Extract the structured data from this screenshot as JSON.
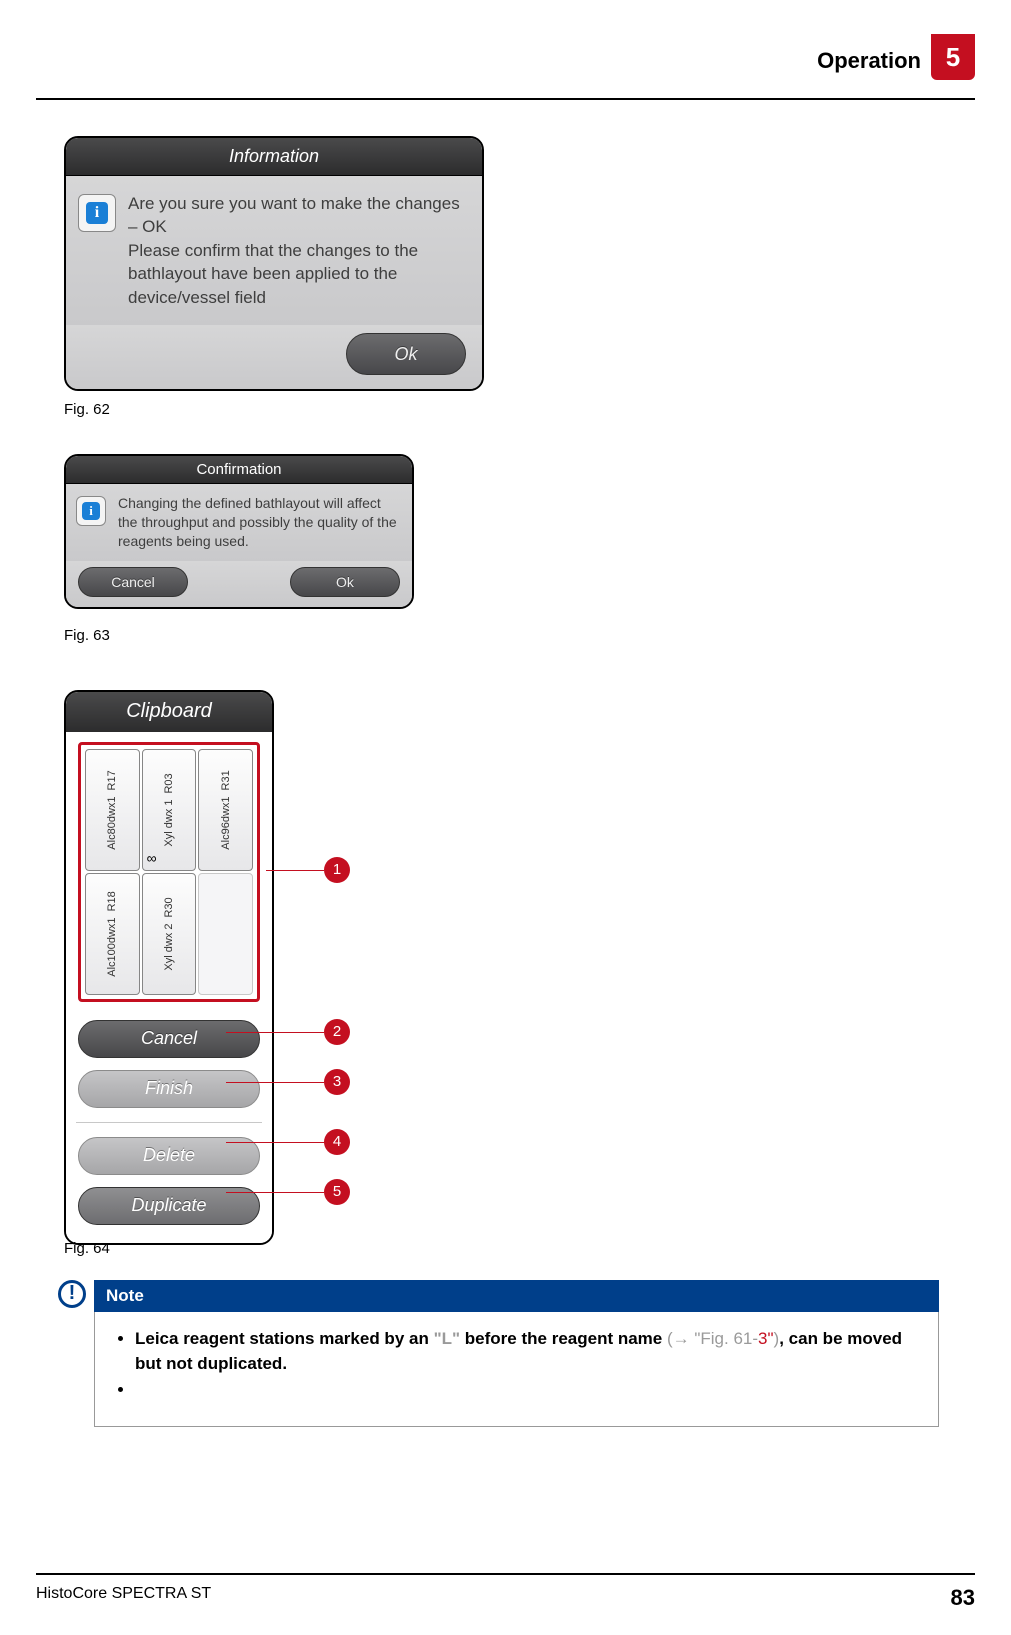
{
  "header": {
    "section": "Operation",
    "chapter": "5"
  },
  "dialog1": {
    "title": "Information",
    "text": "Are you sure you want to make the changes – OK\nPlease confirm that the changes to the bathlayout have been applied to the device/vessel field",
    "ok": "Ok",
    "caption": "Fig. 62"
  },
  "dialog2": {
    "title": "Confirmation",
    "text": "Changing the defined bathlayout will affect the throughput and possibly the quality of the reagents being used.",
    "cancel": "Cancel",
    "ok": "Ok",
    "caption": "Fig. 63"
  },
  "clipboard": {
    "title": "Clipboard",
    "cells": {
      "c1a": {
        "name": "Alc80dwx1",
        "code": "R17"
      },
      "c1b": {
        "name": "Alc100dwx1",
        "code": "R18"
      },
      "c2a": {
        "name": "Xyl dwx 1",
        "code": "R03",
        "inf": "∞"
      },
      "c2b": {
        "name": "Xyl dwx 2",
        "code": "R30"
      },
      "c3a": {
        "name": "Alc96dwx1",
        "code": "R31"
      }
    },
    "buttons": {
      "cancel": "Cancel",
      "finish": "Finish",
      "delete": "Delete",
      "duplicate": "Duplicate"
    },
    "caption": "Fig. 64",
    "markers": {
      "m1": "1",
      "m2": "2",
      "m3": "3",
      "m4": "4",
      "m5": "5"
    }
  },
  "note": {
    "heading": "Note",
    "bullet_pre": "Leica reagent stations marked by an ",
    "bullet_L": "\"L\"",
    "bullet_mid": " before the reagent name ",
    "ref_open": "(→ ",
    "ref_fig": "\"Fig. 61",
    "ref_dash": "-",
    "ref_num": "3\"",
    "ref_close": ")",
    "bullet_post": ", can be moved but not duplicated."
  },
  "footer": {
    "product": "HistoCore SPECTRA ST",
    "page": "83"
  }
}
